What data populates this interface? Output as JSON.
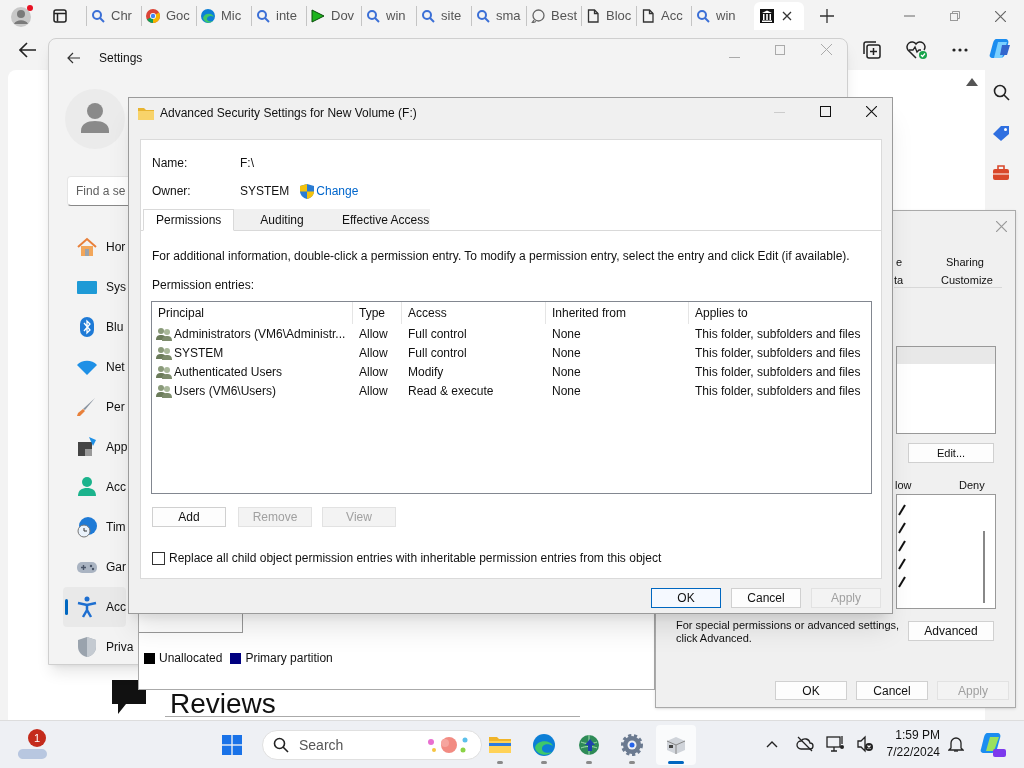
{
  "browser": {
    "tabs": [
      {
        "label": "Chr",
        "selected": false
      },
      {
        "label": "Goc",
        "selected": false
      },
      {
        "label": "Mic",
        "selected": false
      },
      {
        "label": "inte",
        "selected": false
      },
      {
        "label": "Dov",
        "selected": false
      },
      {
        "label": "win",
        "selected": false
      },
      {
        "label": "site",
        "selected": false
      },
      {
        "label": "sma",
        "selected": false
      },
      {
        "label": "Best",
        "selected": false
      },
      {
        "label": "Bloc",
        "selected": false
      },
      {
        "label": "Acc",
        "selected": false
      },
      {
        "label": "win",
        "selected": false
      },
      {
        "selected": true
      }
    ]
  },
  "settings_window": {
    "title": "Settings",
    "search": {
      "placeholder": "Find a se"
    },
    "nav": [
      {
        "label": "Hor",
        "selected": false
      },
      {
        "label": "Sys",
        "selected": false
      },
      {
        "label": "Blu",
        "selected": false
      },
      {
        "label": "Net",
        "selected": false
      },
      {
        "label": "Per",
        "selected": false
      },
      {
        "label": "App",
        "selected": false
      },
      {
        "label": "Acc",
        "selected": false
      },
      {
        "label": "Tim",
        "selected": false
      },
      {
        "label": "Gar",
        "selected": false
      },
      {
        "label": "Acc",
        "selected": true
      },
      {
        "label": "Priva",
        "selected": false
      }
    ]
  },
  "properties_dialog": {
    "tabs_row_1": [
      "e",
      "Sharing"
    ],
    "tabs_row_2": [
      "ta",
      "Customize"
    ],
    "edit_button": "Edit...",
    "columns": [
      "low",
      "Deny"
    ],
    "permission_rows": [
      {
        "allow": true
      },
      {
        "allow": true
      },
      {
        "allow": true
      },
      {
        "allow": true
      },
      {
        "allow": true
      }
    ],
    "note": "For special permissions or advanced settings, click Advanced.",
    "advanced_button": "Advanced",
    "buttons": [
      {
        "label": "OK",
        "disabled": false
      },
      {
        "label": "Cancel",
        "disabled": false
      },
      {
        "label": "Apply",
        "disabled": true
      }
    ]
  },
  "security_dialog": {
    "title": "Advanced Security Settings for New Volume (F:)",
    "name_label": "Name:",
    "name_value": "F:\\",
    "owner_label": "Owner:",
    "owner_value": "SYSTEM",
    "change_link": "Change",
    "tabs": [
      {
        "label": "Permissions",
        "selected": true
      },
      {
        "label": "Auditing",
        "selected": false
      },
      {
        "label": "Effective Access",
        "selected": false
      }
    ],
    "info": "For additional information, double-click a permission entry. To modify a permission entry, select the entry and click Edit (if available).",
    "entries_label": "Permission entries:",
    "table": {
      "columns": [
        "Principal",
        "Type",
        "Access",
        "Inherited from",
        "Applies to"
      ],
      "rows": [
        {
          "principal": "Administrators (VM6\\Administr...",
          "type": "Allow",
          "access": "Full control",
          "inherited_from": "None",
          "applies_to": "This folder, subfolders and files"
        },
        {
          "principal": "SYSTEM",
          "type": "Allow",
          "access": "Full control",
          "inherited_from": "None",
          "applies_to": "This folder, subfolders and files"
        },
        {
          "principal": "Authenticated Users",
          "type": "Allow",
          "access": "Modify",
          "inherited_from": "None",
          "applies_to": "This folder, subfolders and files"
        },
        {
          "principal": "Users (VM6\\Users)",
          "type": "Allow",
          "access": "Read & execute",
          "inherited_from": "None",
          "applies_to": "This folder, subfolders and files"
        }
      ]
    },
    "actions": [
      {
        "label": "Add",
        "disabled": false
      },
      {
        "label": "Remove",
        "disabled": true
      },
      {
        "label": "View",
        "disabled": true
      }
    ],
    "replace_checkbox": {
      "label": "Replace all child object permission entries with inheritable permission entries from this object",
      "checked": false
    },
    "buttons": [
      {
        "label": "OK",
        "disabled": false,
        "default": true
      },
      {
        "label": "Cancel",
        "disabled": false,
        "default": false
      },
      {
        "label": "Apply",
        "disabled": true,
        "default": false
      }
    ]
  },
  "disk_management": {
    "legend": [
      {
        "label": "Unallocated",
        "color": "#000000"
      },
      {
        "label": "Primary partition",
        "color": "#000080"
      }
    ]
  },
  "webpage": {
    "heading": "Reviews"
  },
  "taskbar": {
    "weather_badge": "1",
    "search": {
      "placeholder": "Search"
    },
    "apps": [
      {
        "selected": false
      },
      {
        "selected": false
      },
      {
        "selected": false
      },
      {
        "selected": false
      },
      {
        "selected": true
      }
    ],
    "time": "1:59 PM",
    "date": "7/22/2024"
  }
}
